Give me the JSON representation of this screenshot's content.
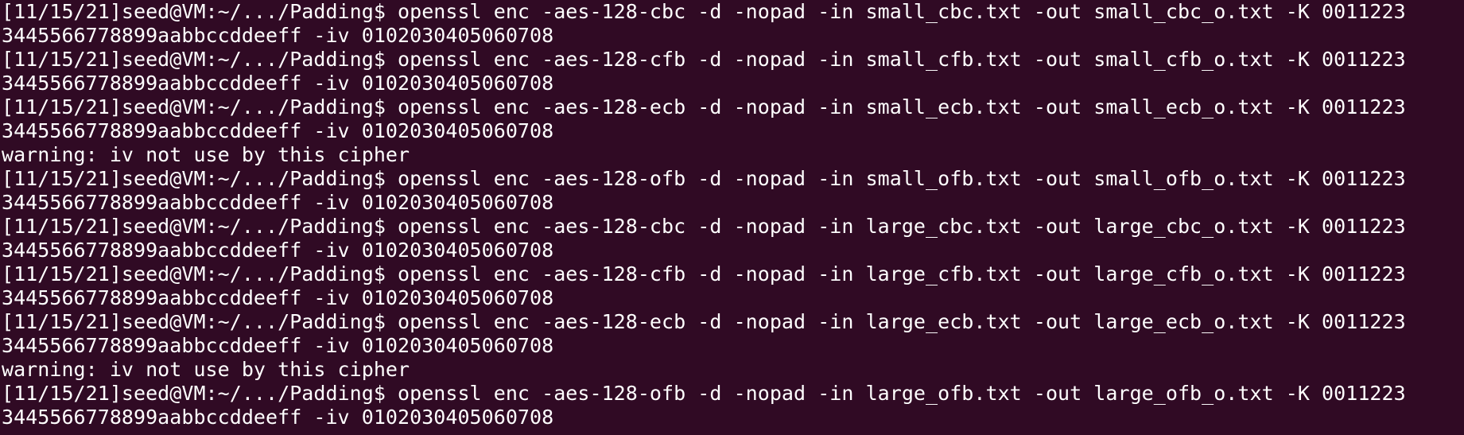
{
  "terminal": {
    "lines": [
      "[11/15/21]seed@VM:~/.../Padding$ openssl enc -aes-128-cbc -d -nopad -in small_cbc.txt -out small_cbc_o.txt -K 0011223",
      "3445566778899aabbccddeeff -iv 0102030405060708",
      "[11/15/21]seed@VM:~/.../Padding$ openssl enc -aes-128-cfb -d -nopad -in small_cfb.txt -out small_cfb_o.txt -K 0011223",
      "3445566778899aabbccddeeff -iv 0102030405060708",
      "[11/15/21]seed@VM:~/.../Padding$ openssl enc -aes-128-ecb -d -nopad -in small_ecb.txt -out small_ecb_o.txt -K 0011223",
      "3445566778899aabbccddeeff -iv 0102030405060708",
      "warning: iv not use by this cipher",
      "[11/15/21]seed@VM:~/.../Padding$ openssl enc -aes-128-ofb -d -nopad -in small_ofb.txt -out small_ofb_o.txt -K 0011223",
      "3445566778899aabbccddeeff -iv 0102030405060708",
      "[11/15/21]seed@VM:~/.../Padding$ openssl enc -aes-128-cbc -d -nopad -in large_cbc.txt -out large_cbc_o.txt -K 0011223",
      "3445566778899aabbccddeeff -iv 0102030405060708",
      "[11/15/21]seed@VM:~/.../Padding$ openssl enc -aes-128-cfb -d -nopad -in large_cfb.txt -out large_cfb_o.txt -K 0011223",
      "3445566778899aabbccddeeff -iv 0102030405060708",
      "[11/15/21]seed@VM:~/.../Padding$ openssl enc -aes-128-ecb -d -nopad -in large_ecb.txt -out large_ecb_o.txt -K 0011223",
      "3445566778899aabbccddeeff -iv 0102030405060708",
      "warning: iv not use by this cipher",
      "[11/15/21]seed@VM:~/.../Padding$ openssl enc -aes-128-ofb -d -nopad -in large_ofb.txt -out large_ofb_o.txt -K 0011223",
      "3445566778899aabbccddeeff -iv 0102030405060708"
    ]
  },
  "colors": {
    "background": "#300a24",
    "text": "#ffffff"
  }
}
